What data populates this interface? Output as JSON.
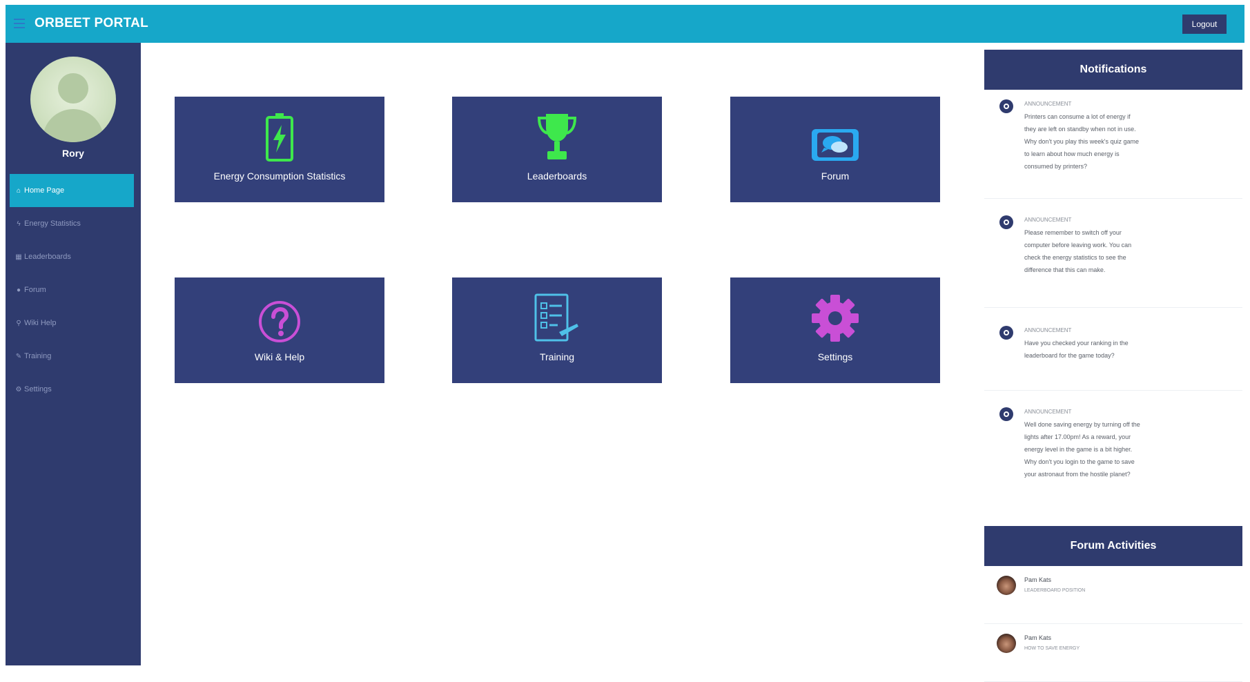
{
  "header": {
    "brand": "ORBEET PORTAL",
    "logout_label": "Logout",
    "menu_icon": "hamburger-icon",
    "bar_color": "#16a7c9"
  },
  "sidebar": {
    "username": "Rory",
    "background": "#2f3b6e",
    "active_color": "#16a7c9",
    "items": [
      {
        "label": "Home Page",
        "icon": "home-icon",
        "glyph": "⌂"
      },
      {
        "label": "Energy Statistics",
        "icon": "bolt-icon",
        "glyph": "ϟ"
      },
      {
        "label": "Leaderboards",
        "icon": "table-icon",
        "glyph": "▦"
      },
      {
        "label": "Forum",
        "icon": "speech-bubble-icon",
        "glyph": "●"
      },
      {
        "label": "Wiki Help",
        "icon": "search-icon",
        "glyph": "⚲"
      },
      {
        "label": "Training",
        "icon": "graduation-icon",
        "glyph": "✎"
      },
      {
        "label": "Settings",
        "icon": "gear-icon",
        "glyph": "⚙"
      }
    ]
  },
  "tiles": [
    {
      "label": "Energy Consumption Statistics",
      "icon": "battery-bolt-icon",
      "icon_color": "#3ee84c"
    },
    {
      "label": "Leaderboards",
      "icon": "trophy-icon",
      "icon_color": "#3ee84c"
    },
    {
      "label": "Forum",
      "icon": "chat-bubbles-icon",
      "icon_color": "#2aa9f0"
    },
    {
      "label": "Wiki & Help",
      "icon": "question-circle-icon",
      "icon_color": "#c94fd6"
    },
    {
      "label": "Training",
      "icon": "checklist-icon",
      "icon_color": "#4fc1e8"
    },
    {
      "label": "Settings",
      "icon": "gear-icon",
      "icon_color": "#c94fd6"
    }
  ],
  "notifications": {
    "title": "Notifications",
    "items": [
      {
        "kind": "ANNOUNCEMENT",
        "text": "Printers can consume a lot of energy if they are left on standby when not in use. Why don't you play this week's quiz game to learn about how much energy is consumed by printers?"
      },
      {
        "kind": "ANNOUNCEMENT",
        "text": "Please remember to switch off your computer before leaving work. You can check the energy statistics to see the difference that this can make."
      },
      {
        "kind": "ANNOUNCEMENT",
        "text": "Have you checked your ranking in the leaderboard for the game today?"
      },
      {
        "kind": "ANNOUNCEMENT",
        "text": "Well done saving energy by turning off the lights after 17.00pm! As a reward, your energy level in the game is a bit higher. Why don't you login to the game to save your astronaut from the hostile planet?"
      }
    ]
  },
  "forum_activities": {
    "title": "Forum Activities",
    "items": [
      {
        "name": "Pam Kats",
        "topic": "LEADERBOARD POSITION"
      },
      {
        "name": "Pam Kats",
        "topic": "HOW TO SAVE ENERGY"
      }
    ]
  }
}
